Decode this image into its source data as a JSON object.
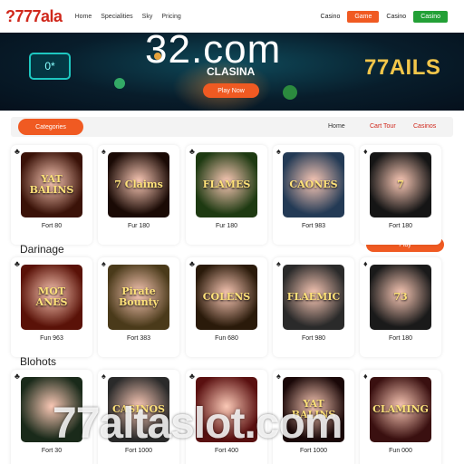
{
  "header": {
    "logo": "?777ala",
    "nav": [
      "Home",
      "Specialities",
      "Sky",
      "Pricing"
    ],
    "casino": "Casino",
    "btn_primary": "Game",
    "casino2": "Casino",
    "btn_secondary": "Casino"
  },
  "banner": {
    "domain": "32.com",
    "subtitle": "CLASINA",
    "cta": "Play Now",
    "right_text": "77AILS",
    "icon_text": "0*"
  },
  "filters": {
    "pill": "Categories",
    "links": [
      "Home",
      "Cart Tour",
      "Casinos"
    ]
  },
  "sections": [
    "Darinage",
    "Blohots"
  ],
  "orange_pill": "Play",
  "rows": [
    [
      {
        "title": "YAT BALINS",
        "label": "Fort 80"
      },
      {
        "title": "7 Claims",
        "label": "Fur 180"
      },
      {
        "title": "FLAMES",
        "label": "Fur 180"
      },
      {
        "title": "CAONES",
        "label": "Fort 983"
      },
      {
        "title": "7",
        "label": "Fort 180"
      }
    ],
    [
      {
        "title": "MOT ANES",
        "label": "Fun 963"
      },
      {
        "title": "Pirate Bounty",
        "label": "Fort 383"
      },
      {
        "title": "COLENS",
        "label": "Fun 680"
      },
      {
        "title": "FLAEMIC",
        "label": "Fort 980"
      },
      {
        "title": "73",
        "label": "Fort 180"
      }
    ],
    [
      {
        "title": "",
        "label": "Fort 30"
      },
      {
        "title": "CASINOS",
        "label": "Fort 1000"
      },
      {
        "title": "",
        "label": "Fort 400"
      },
      {
        "title": "YAT BALINS",
        "label": "Fort 1000"
      },
      {
        "title": "CLAMING",
        "label": "Fun 000"
      }
    ]
  ],
  "watermark": "77altaslot.com",
  "colors": {
    "accent": "#f05a22",
    "brand_red": "#d0281c",
    "green": "#23a036"
  }
}
